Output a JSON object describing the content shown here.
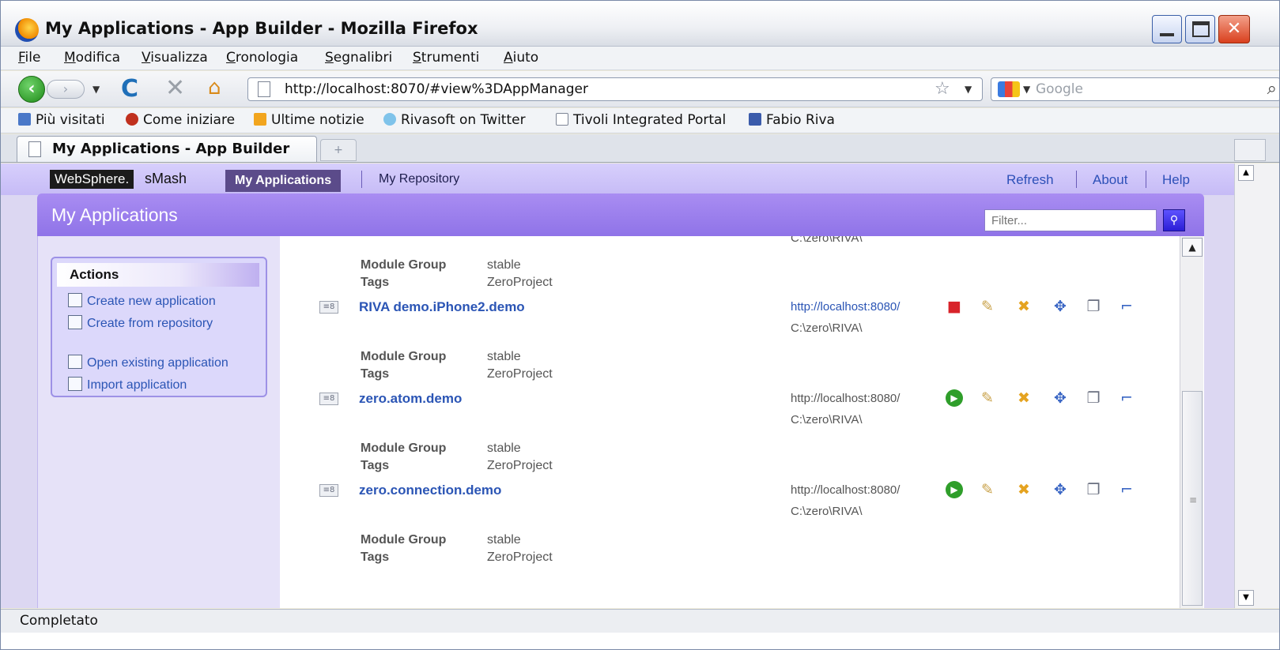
{
  "window": {
    "title": "My Applications - App Builder - Mozilla Firefox"
  },
  "menu": [
    "File",
    "Modifica",
    "Visualizza",
    "Cronologia",
    "Segnalibri",
    "Strumenti",
    "Aiuto"
  ],
  "navbar": {
    "url": "http://localhost:8070/#view%3DAppManager",
    "search_placeholder": "Google"
  },
  "bookmarks": [
    {
      "label": "Più visitati",
      "icon": "most-visited-icon"
    },
    {
      "label": "Come iniziare",
      "icon": "firefox-icon"
    },
    {
      "label": "Ultime notizie",
      "icon": "rss-icon"
    },
    {
      "label": "Rivasoft on Twitter",
      "icon": "twitter-icon"
    },
    {
      "label": "Tivoli Integrated Portal",
      "icon": "page-icon"
    },
    {
      "label": "Fabio Riva",
      "icon": "facebook-icon"
    }
  ],
  "tab": {
    "label": "My Applications - App Builder",
    "newtab": "+"
  },
  "app": {
    "logo": "WebSphere.",
    "product": "sMash",
    "nav_active": "My Applications",
    "nav_other": "My Repository",
    "links": [
      "Refresh",
      "About",
      "Help"
    ],
    "banner_title": "My Applications",
    "filter_placeholder": "Filter..."
  },
  "actions": {
    "title": "Actions",
    "items": [
      "Create new application",
      "Create from repository",
      "Open existing application",
      "Import application"
    ]
  },
  "list": {
    "partial_path": "C:\\zero\\RIVA\\",
    "label_module_group": "Module Group",
    "label_tags": "Tags",
    "top_module_group": "stable",
    "top_tags": "ZeroProject",
    "apps": [
      {
        "name": "RIVA demo.iPhone2.demo",
        "url": "http://localhost:8080/",
        "path": "C:\\zero\\RIVA\\",
        "module_group": "stable",
        "tags": "ZeroProject",
        "status": "running"
      },
      {
        "name": "zero.atom.demo",
        "url": "http://localhost:8080/",
        "path": "C:\\zero\\RIVA\\",
        "module_group": "stable",
        "tags": "ZeroProject",
        "status": "stopped"
      },
      {
        "name": "zero.connection.demo",
        "url": "http://localhost:8080/",
        "path": "C:\\zero\\RIVA\\",
        "module_group": "stable",
        "tags": "ZeroProject",
        "status": "stopped"
      }
    ]
  },
  "status": "Completato"
}
